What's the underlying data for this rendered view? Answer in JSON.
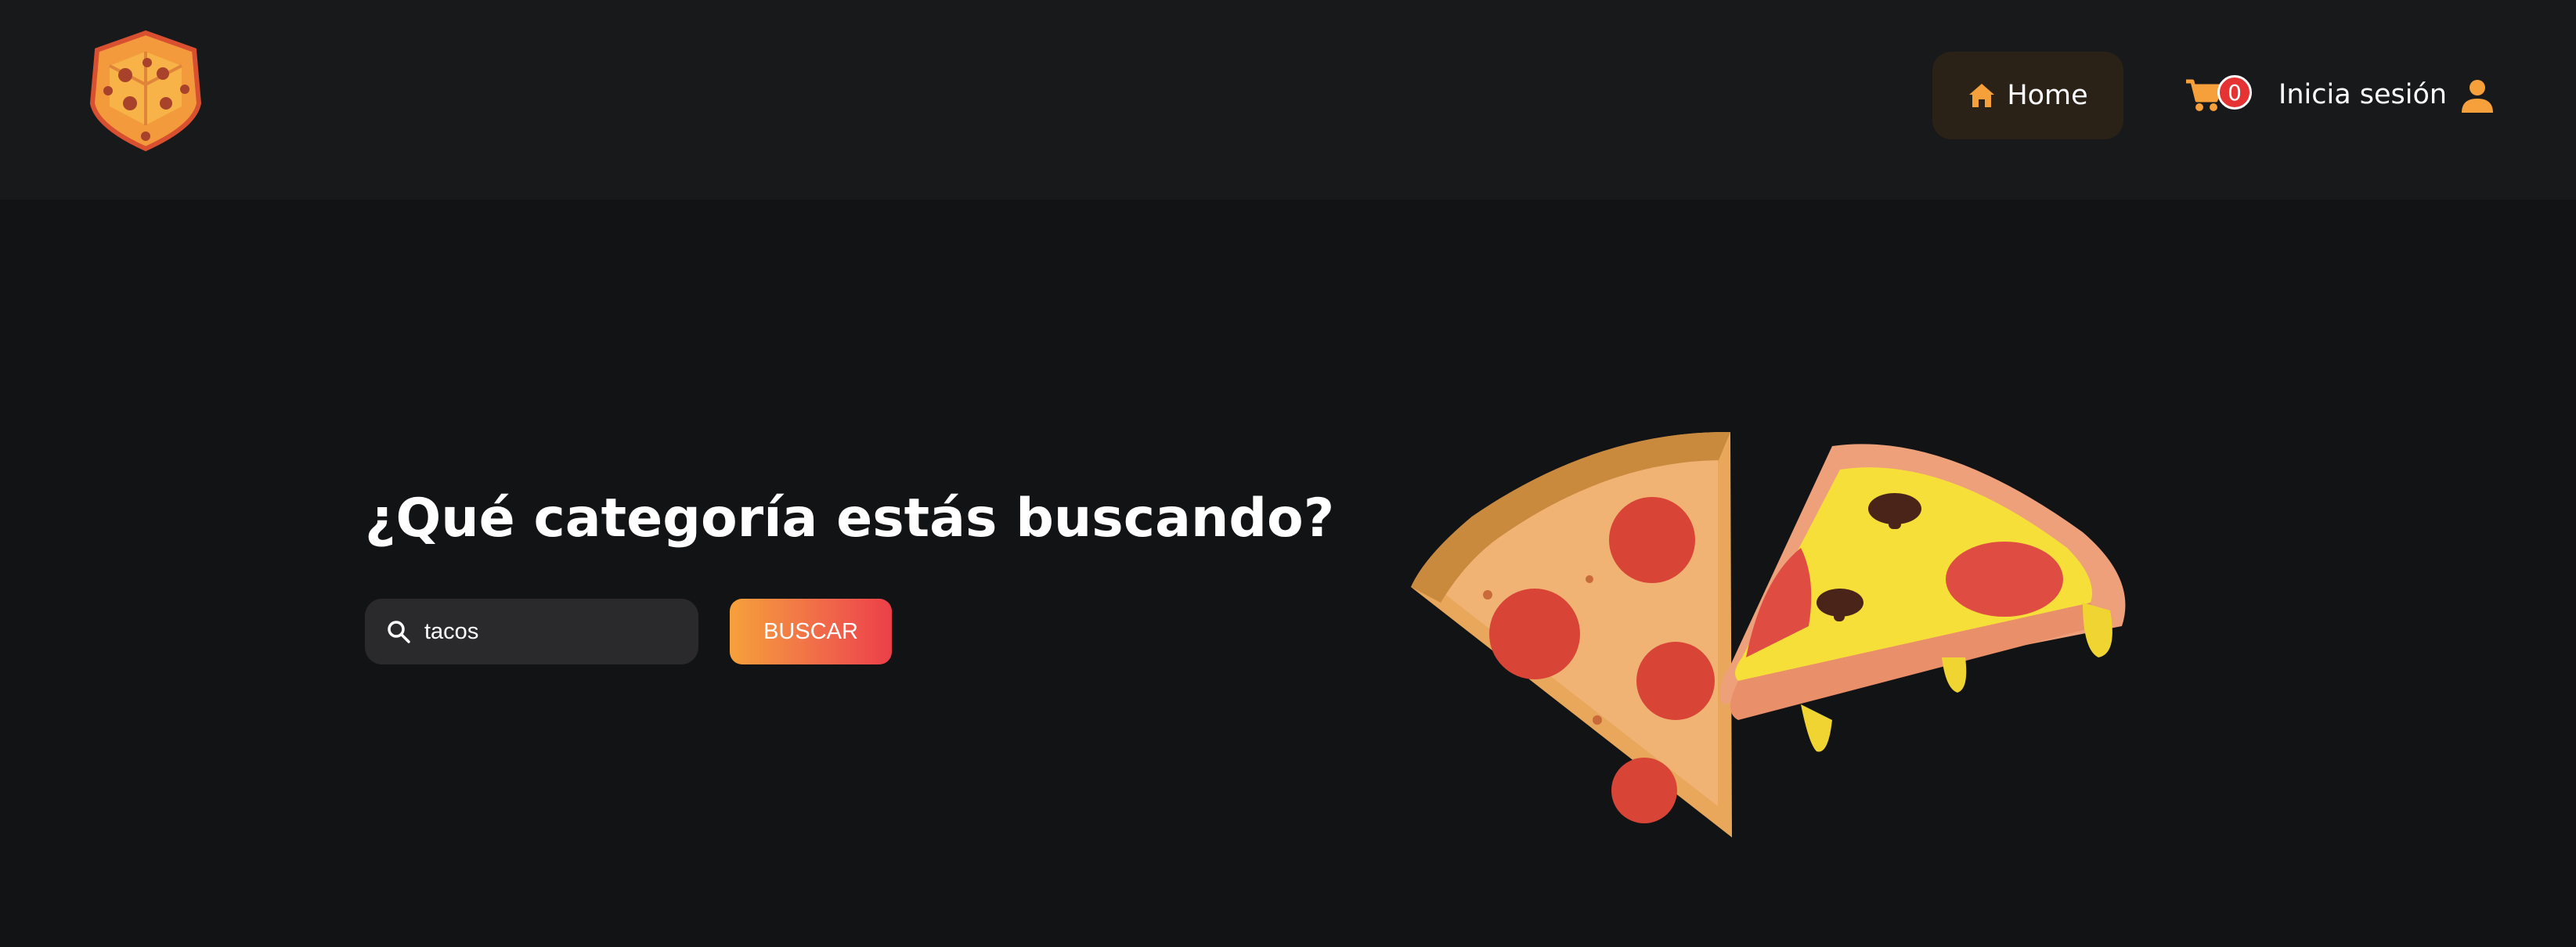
{
  "header": {
    "logo_icon": "pizza-box-logo-icon",
    "nav": {
      "home_label": "Home",
      "home_icon": "house-icon"
    },
    "cart": {
      "icon": "shopping-cart-icon",
      "count": "0"
    },
    "login_label": "Inicia sesión",
    "user_icon": "user-icon"
  },
  "hero": {
    "title": "¿Qué categoría estás buscando?",
    "search": {
      "value": "tacos",
      "icon": "search-icon"
    },
    "search_button_label": "BUSCAR",
    "illustration": "pizza-slices-illustration"
  },
  "colors": {
    "background": "#121315",
    "header": "#18191b",
    "accent_orange": "#f5a03a",
    "accent_red": "#ec3f49",
    "input_bg": "#2a2a2c",
    "home_button_bg": "#2a2117"
  }
}
